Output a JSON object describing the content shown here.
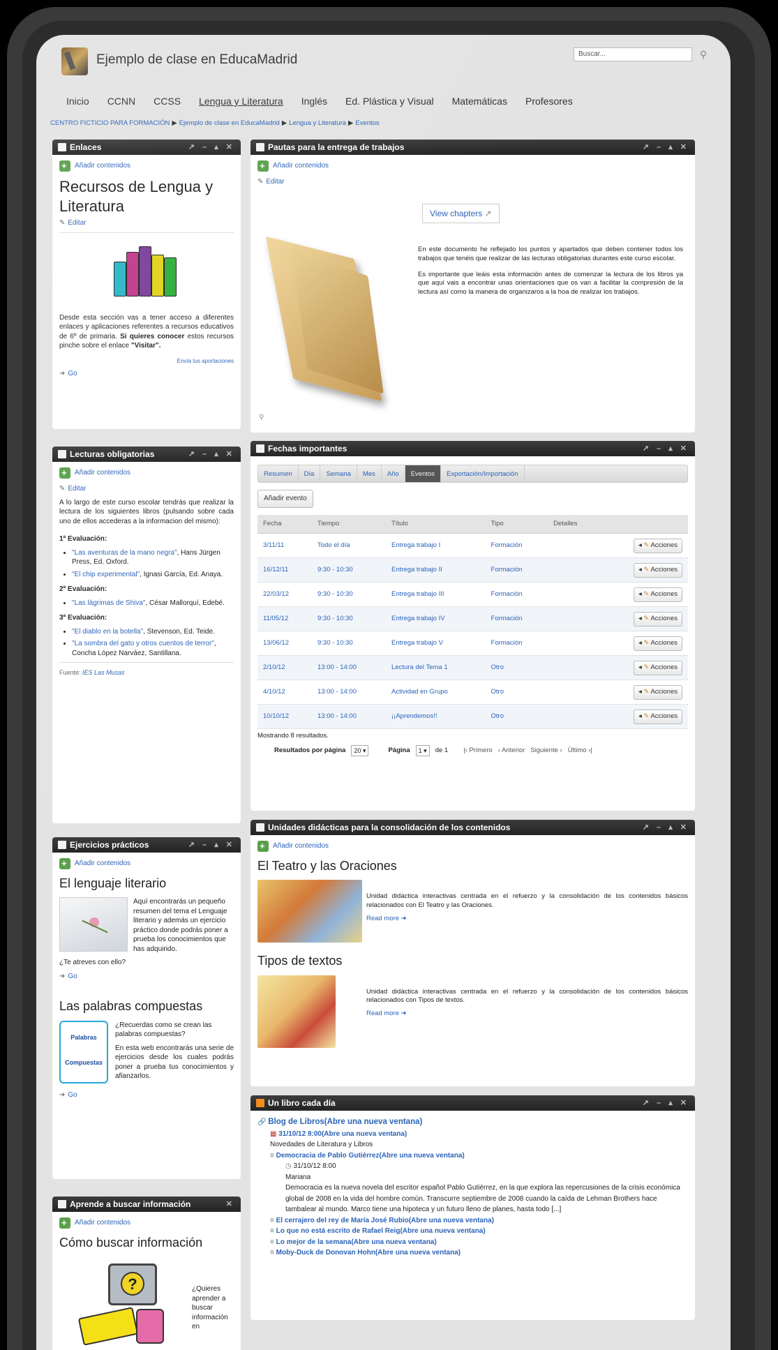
{
  "header": {
    "site_title": "Ejemplo de clase en EducaMadrid",
    "search_placeholder": "Buscar..."
  },
  "nav": [
    "Inicio",
    "CCNN",
    "CCSS",
    "Lengua y Literatura",
    "Inglés",
    "Ed. Plástica y Visual",
    "Matemáticas",
    "Profesores"
  ],
  "nav_active": "Lengua y Literatura",
  "breadcrumb": [
    "CENTRO FICTICIO PARA FORMACIÓN",
    "Ejemplo de clase en EducaMadrid",
    "Lengua y Literatura",
    "Eventos"
  ],
  "common": {
    "add_content": "Añadir contenidos",
    "edit": "Editar",
    "go": "Go",
    "read_more": "Read more"
  },
  "enlaces": {
    "title": "Enlaces",
    "heading": "Recursos de Lengua y Literatura",
    "text_plain": "Desde esta sección vas a tener acceso a diferentes enlaces y aplicaciones referentes a recursos educativos de 6º de primaria.",
    "text_bold": "Si quieres conocer",
    "text_plain2": "estos recursos pinche sobre el enlace",
    "text_bold2": "\"Visitar\".",
    "contribute": "Envía tus aportaciones"
  },
  "lecturas": {
    "title": "Lecturas obligatorias",
    "intro": "A lo largo de este curso escolar tendrás que realizar la lectura de los siguientes libros (pulsando sobre cada uno de ellos accederas a la informacion del mismo):",
    "sections": [
      {
        "label": "1ª Evaluación:",
        "items": [
          {
            "link": "\"Las aventuras de la mano negra\"",
            "rest": ", Hans Jürgen Press, Ed. Oxford."
          },
          {
            "link": "\"El chip experimental\"",
            "rest": ", Ignasi García, Ed. Anaya."
          }
        ]
      },
      {
        "label": "2ª Evaluación:",
        "items": [
          {
            "link": "\"Las lágrimas de Shiva\"",
            "rest": ", César Mallorquí, Edebé."
          }
        ]
      },
      {
        "label": "3ª Evaluación:",
        "items": [
          {
            "link": "\"El diablo en la botella\"",
            "rest": ", Stevenson, Ed. Teide."
          },
          {
            "link": "\"La sombra del gato y otros cuentos de terror\"",
            "rest": ", Concha López Narváez, Santillana."
          }
        ]
      }
    ],
    "source_label": "Fuente:",
    "source_link": "IES Las Musas"
  },
  "ejercicios": {
    "title": "Ejercicios prácticos",
    "h1": "El lenguaje literario",
    "p1": "Aquí encontrarás un pequeño resumen del tema el Lenguaje literario y además un ejercicio práctico donde podrás poner a prueba los conocimientos que has adquirido.",
    "p1b": "¿Te atreves con ello?",
    "h2": "Las palabras compuestas",
    "p2a": "¿Recuerdas como se crean las palabras compuestas?",
    "p2b": "En esta web encontrarás una serie de ejercicios desde los cuales podrás poner a prueba tus conocimientos y afianzarlos.",
    "img2_top": "Palabras",
    "img2_bottom": "Compuestas"
  },
  "aprende": {
    "title": "Aprende a buscar información",
    "heading": "Cómo buscar información",
    "text": "¿Quieres aprender a buscar información en"
  },
  "pautas": {
    "title": "Pautas para la entrega de trabajos",
    "view_chapters": "View chapters",
    "p1": "En este documento he reflejado los puntos y apartados que deben contener todos los trabajos que tenéis que realizar de las lecturas obligatorias durantes este curso escolar.",
    "p2": "Es importante que leáis esta información antes de comenzar la lectura de los libros ya que aquí vais a encontrar unas orientaciones que os van a facilitar la compresión de la lectura así como la manera de organizaros a la hoa de realizar los trabajos."
  },
  "fechas": {
    "title": "Fechas importantes",
    "tabs": [
      "Resumen",
      "Día",
      "Semana",
      "Mes",
      "Año",
      "Eventos",
      "Exportación/Importación"
    ],
    "active_tab": "Eventos",
    "add_event": "Añadir evento",
    "columns": [
      "Fecha",
      "Tiempo",
      "Título",
      "Tipo",
      "Detalles",
      ""
    ],
    "actions_label": "Acciones",
    "rows": [
      {
        "fecha": "3/11/11",
        "tiempo": "Todo el día",
        "titulo": "Entrega trabajo I",
        "tipo": "Formación"
      },
      {
        "fecha": "16/12/11",
        "tiempo": "9:30 - 10:30",
        "titulo": "Entrega trabajo II",
        "tipo": "Formación"
      },
      {
        "fecha": "22/03/12",
        "tiempo": "9:30 - 10:30",
        "titulo": "Entrega trabajo III",
        "tipo": "Formación"
      },
      {
        "fecha": "11/05/12",
        "tiempo": "9:30 - 10:30",
        "titulo": "Entrega trabajo IV",
        "tipo": "Formación"
      },
      {
        "fecha": "13/06/12",
        "tiempo": "9:30 - 10:30",
        "titulo": "Entrega trabajo V",
        "tipo": "Formación"
      },
      {
        "fecha": "2/10/12",
        "tiempo": "13:00 - 14:00",
        "titulo": "Lectura del Tema 1",
        "tipo": "Otro"
      },
      {
        "fecha": "4/10/12",
        "tiempo": "13:00 - 14:00",
        "titulo": "Actividad en Grupo",
        "tipo": "Otro"
      },
      {
        "fecha": "10/10/12",
        "tiempo": "13:00 - 14:00",
        "titulo": "¡¡Aprendemos!!",
        "tipo": "Otro"
      }
    ],
    "showing": "Mostrando 8 resultados.",
    "per_page_label": "Resultados por página",
    "per_page_value": "20",
    "page_label": "Página",
    "page_value": "1",
    "page_of": "de 1",
    "first": "|‹ Primero",
    "prev": "‹ Anterior",
    "next": "Siguiente ›",
    "last": "Último ›|"
  },
  "unidades": {
    "title": "Unidades didácticas para la consolidación de los contenidos",
    "items": [
      {
        "heading": "El Teatro y las Oraciones",
        "text": "Unidad didáctica interactivas centrada en el refuerzo y la consolidación de los contenidos básicos relacionados con El Teatro y las Oraciones."
      },
      {
        "heading": "Tipos de textos",
        "text": "Unidad didáctica interactivas centrada en el refuerzo y la consolidación de los contenidos básicos relacionados con Tipos de textos."
      }
    ]
  },
  "libro": {
    "title": "Un libro cada día",
    "blog": "Blog de Libros(Abre una nueva ventana)",
    "date_link": "31/10/12 8:00(Abre una nueva ventana)",
    "subtitle": "Novedades de Literatura y Libros",
    "first_item": "Democracia de Pablo Gutiérrez(Abre una nueva ventana)",
    "first_date": "31/10/12 8:00",
    "author": "Mariana",
    "excerpt": "Democracia es la nueva novela del escritor español Pablo Gutiérrez, en la que explora las repercusiones de la crisis económica global de 2008 en la vida del hombre común. Transcurre septiembre de 2008 cuando la caída de Lehman Brothers hace tambalear al mundo. Marco tiene una hipoteca y un futuro lleno de planes, hasta todo [...]",
    "more_items": [
      "El cerrajero del rey de María José Rubio(Abre una nueva ventana)",
      "Lo que no está escrito de Rafael Reig(Abre una nueva ventana)",
      "Lo mejor de la semana(Abre una nueva ventana)",
      "Moby-Duck de Donovan Hohn(Abre una nueva ventana)"
    ]
  }
}
